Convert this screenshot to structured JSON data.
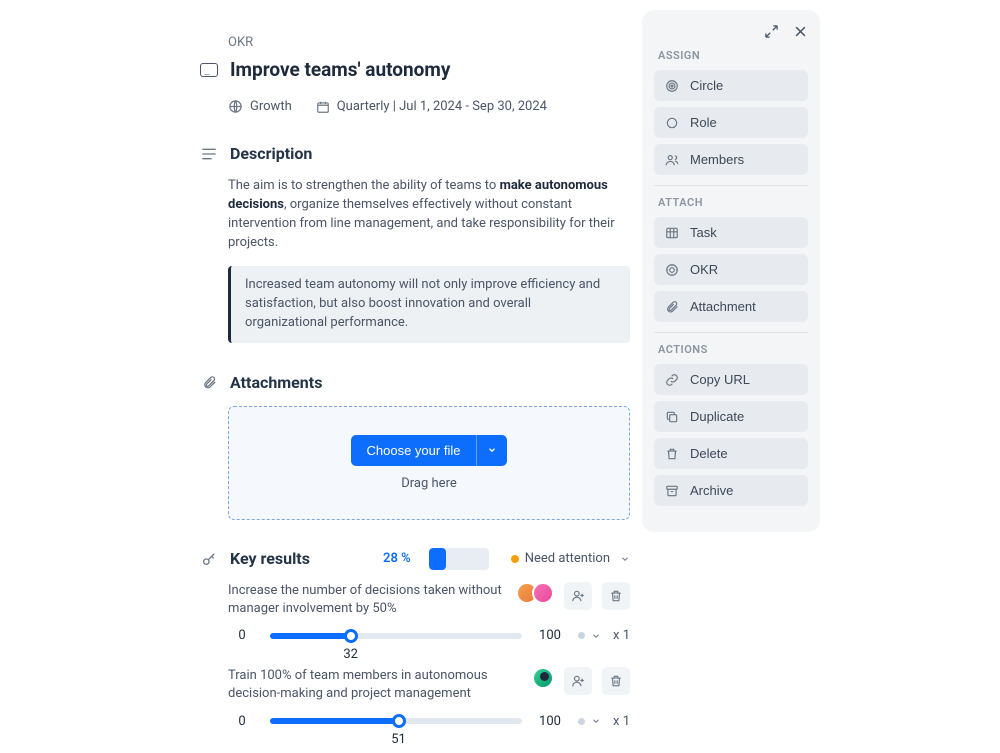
{
  "breadcrumb": "OKR",
  "title": "Improve teams' autonomy",
  "meta": {
    "area": "Growth",
    "period": "Quarterly | Jul 1, 2024 - Sep 30, 2024"
  },
  "sections": {
    "description_label": "Description",
    "attachments_label": "Attachments",
    "key_results_label": "Key results"
  },
  "description": {
    "prefix": "The aim is to strengthen the ability of teams to ",
    "bold": "make autonomous decisions",
    "suffix": ", organize themselves effectively without constant intervention from line management, and take responsibility for their projects.",
    "callout": "Increased team autonomy will not only improve efficiency and satisfaction, but also boost innovation and overall organizational performance."
  },
  "attachments": {
    "button": "Choose your file",
    "drag": "Drag here"
  },
  "key_results": {
    "percent_label": "28 %",
    "percent_value": 28,
    "status_label": "Need attention",
    "items": [
      {
        "title": "Increase the number of decisions taken without manager involvement by 50%",
        "min": "0",
        "max": "100",
        "value": 32,
        "value_label": "32",
        "multiplier": "x 1",
        "avatars": [
          "a1",
          "a2"
        ]
      },
      {
        "title": "Train 100% of team members in autonomous decision-making and project management",
        "min": "0",
        "max": "100",
        "value": 51,
        "value_label": "51",
        "multiplier": "x 1",
        "avatars": [
          "a3"
        ]
      }
    ]
  },
  "sidebar": {
    "assign_label": "ASSIGN",
    "attach_label": "ATTACH",
    "actions_label": "ACTIONS",
    "assign": [
      {
        "icon": "target",
        "label": "Circle"
      },
      {
        "icon": "circle",
        "label": "Role"
      },
      {
        "icon": "members",
        "label": "Members"
      }
    ],
    "attach": [
      {
        "icon": "task",
        "label": "Task"
      },
      {
        "icon": "okr",
        "label": "OKR"
      },
      {
        "icon": "clip",
        "label": "Attachment"
      }
    ],
    "actions": [
      {
        "icon": "link",
        "label": "Copy URL"
      },
      {
        "icon": "dup",
        "label": "Duplicate"
      },
      {
        "icon": "trash",
        "label": "Delete"
      },
      {
        "icon": "archive",
        "label": "Archive"
      }
    ]
  }
}
